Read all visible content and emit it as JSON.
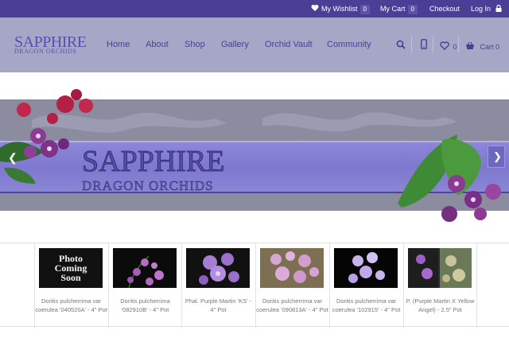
{
  "topbar": {
    "wishlist_label": "My Wishlist",
    "wishlist_count": "0",
    "cart_label": "My Cart",
    "cart_count": "0",
    "checkout_label": "Checkout",
    "login_label": "Log In"
  },
  "header": {
    "logo_main": "SAPPHIRE",
    "logo_sub": "DRAGON ORCHIDS",
    "nav": [
      "Home",
      "About",
      "Shop",
      "Gallery",
      "Orchid Vault",
      "Community"
    ],
    "wishlist_count": "0",
    "cart_label": "Cart 0"
  },
  "hero": {
    "title": "SAPPHIRE",
    "subtitle": "DRAGON ORCHIDS"
  },
  "products": [
    {
      "name": "Doritis pulcherrima var coerulea '040520A' - 4\" Pot",
      "photo_text_1": "Photo",
      "photo_text_2": "Coming",
      "photo_text_3": "Soon"
    },
    {
      "name": "Doritis pulcherrima '082910B' - 4\" Pot"
    },
    {
      "name": "Phal. Purple Martin 'KS' - 4\" Pot"
    },
    {
      "name": "Doritis pulcherrima var coerulea '090813A' - 4\" Pot"
    },
    {
      "name": "Doritis pulcherrima var coerulea '102915' - 4\" Pot"
    },
    {
      "name": "P. (Purple Martin X Yellow Angel) - 2.5\" Pot"
    }
  ],
  "colors": {
    "topbar": "#4a3f96",
    "navbar": "#a6a6c7",
    "accent": "#5a4fb0"
  }
}
